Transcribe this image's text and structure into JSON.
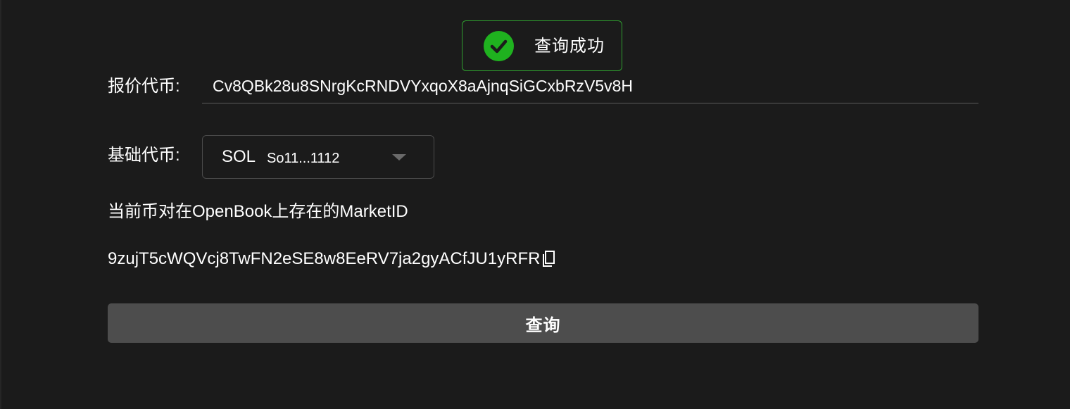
{
  "toast": {
    "message": "查询成功",
    "icon": "check-circle-icon",
    "accent_color": "#1fb21f"
  },
  "form": {
    "quote_token": {
      "label": "报价代币:",
      "value": "Cv8QBk28u8SNrgKcRNDVYxqoX8aAjnqSiGCxbRzV5v8H"
    },
    "base_token": {
      "label": "基础代币:",
      "selected_symbol": "SOL",
      "selected_address": "So11...1112",
      "icon": "chevron-down-icon"
    }
  },
  "result": {
    "heading": "当前币对在OpenBook上存在的MarketID",
    "market_id": "9zujT5cWQVcj8TwFN2eSE8w8EeRV7ja2gyACfJU1yRFR",
    "copy_icon": "copy-icon"
  },
  "actions": {
    "query_label": "查询"
  }
}
